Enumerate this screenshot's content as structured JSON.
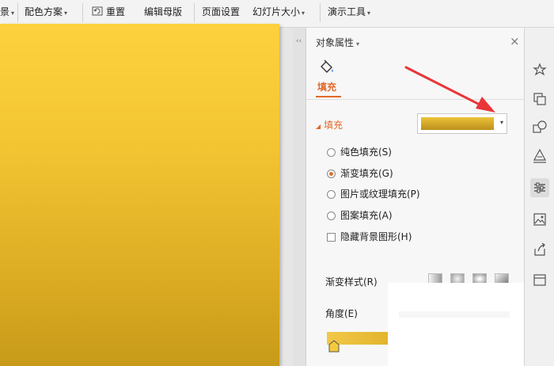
{
  "toolbar": {
    "items": [
      {
        "label": "景",
        "dropdown": true
      },
      {
        "label": "配色方案",
        "dropdown": true
      },
      {
        "label": "重置",
        "dropdown": false
      },
      {
        "label": "编辑母版",
        "dropdown": false
      },
      {
        "label": "页面设置",
        "dropdown": false
      },
      {
        "label": "幻灯片大小",
        "dropdown": true
      },
      {
        "label": "演示工具",
        "dropdown": true
      }
    ],
    "caret": "▾"
  },
  "panel": {
    "title": "对象属性",
    "title_caret": "▾",
    "close": "×",
    "tab_label": "填充",
    "section_title": "填充",
    "section_tri": "◢",
    "dropdown_caret": "▾",
    "gradient_color": "#d9ab27",
    "options": [
      {
        "label": "纯色填充(S)",
        "type": "radio",
        "checked": false
      },
      {
        "label": "渐变填充(G)",
        "type": "radio",
        "checked": true
      },
      {
        "label": "图片或纹理填充(P)",
        "type": "radio",
        "checked": false
      },
      {
        "label": "图案填充(A)",
        "type": "radio",
        "checked": false
      },
      {
        "label": "隐藏背景图形(H)",
        "type": "checkbox",
        "checked": false
      }
    ],
    "gradient_style_label": "渐变样式(R)",
    "angle_label": "角度(E)"
  },
  "sidebar": {
    "icons": [
      "star-pin-icon",
      "copy-icon",
      "shapes-icon",
      "pen-icon",
      "sliders-icon",
      "images-icon",
      "share-icon",
      "layout-icon"
    ],
    "active": "sliders-icon"
  },
  "colors": {
    "accent": "#e4692a",
    "annotation_arrow": "#e8363a",
    "slide_gradient_top": "#fdd13e",
    "slide_gradient_bottom": "#c79a19"
  }
}
